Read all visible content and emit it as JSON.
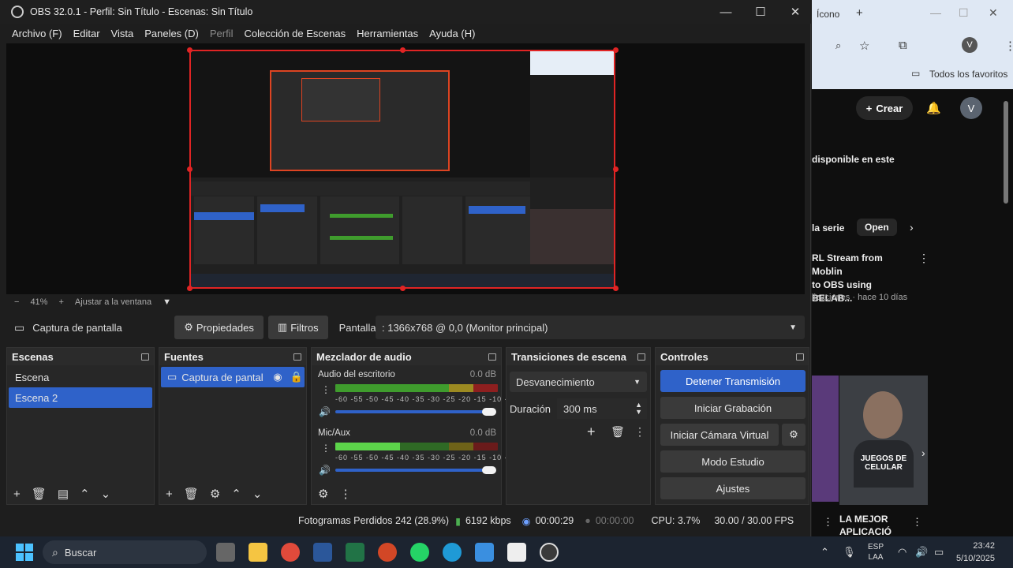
{
  "window": {
    "title": "OBS 32.0.1 - Perfil: Sin Título - Escenas: Sin Título",
    "minimize": "—",
    "maximize": "☐",
    "close": "✕"
  },
  "menu": [
    "Archivo (F)",
    "Editar",
    "Vista",
    "Paneles (D)",
    "Perfil",
    "Colección de Escenas",
    "Herramientas",
    "Ayuda (H)"
  ],
  "zoom": {
    "minus": "−",
    "value": "41%",
    "plus": "+",
    "fit_label": "Ajustar a la ventana"
  },
  "source_bar": {
    "source_name": "Captura de pantalla",
    "properties": "Propiedades",
    "filters": "Filtros",
    "display_label": "Pantalla",
    "display_value": ": 1366x768 @ 0,0 (Monitor principal)"
  },
  "scenes": {
    "title": "Escenas",
    "items": [
      "Escena",
      "Escena 2"
    ],
    "selected": 1
  },
  "sources": {
    "title": "Fuentes",
    "items": [
      "Captura de pantal"
    ]
  },
  "mixer": {
    "title": "Mezclador de audio",
    "tracks": [
      {
        "name": "Audio del escritorio",
        "db": "0.0 dB",
        "level": 0.77
      },
      {
        "name": "Mic/Aux",
        "db": "0.0 dB",
        "level": 0.6
      }
    ],
    "scale": "-60 -55 -50 -45 -40 -35 -30 -25 -20 -15 -10 -5 0"
  },
  "transitions": {
    "title": "Transiciones de escena",
    "selected": "Desvanecimiento",
    "duration_label": "Duración",
    "duration_value": "300 ms"
  },
  "controls": {
    "title": "Controles",
    "buttons": [
      "Detener Transmisión",
      "Iniciar Grabación",
      "Iniciar Cámara Virtual",
      "Modo Estudio",
      "Ajustes"
    ]
  },
  "status": {
    "dropped": "Fotogramas Perdidos 242 (28.9%)",
    "bitrate": "6192 kbps",
    "stream_time": "00:00:29",
    "rec_time": "00:00:00",
    "cpu": "CPU: 3.7%",
    "fps": "30.00 / 30.00 FPS"
  },
  "browser": {
    "tab_title": "Ícono",
    "favorites": "Todos los favoritos",
    "create": "Crear",
    "avatar": "V",
    "available": "disponible en este",
    "chip1": "la serie",
    "chip2": "Open",
    "video_title": "RL Stream from Moblin\nto OBS using BELAB...",
    "video_meta": "lizaciones · hace 10 días",
    "thumb_text": "JUEGOS DE\nCELULAR",
    "video2_title": "LA MEJOR\nAPLICACIÓ"
  },
  "taskbar": {
    "search": "Buscar",
    "lang": "ESP\nLAA",
    "time": "23:42",
    "date": "5/10/2025"
  },
  "colors": {
    "accent": "#2f62c9",
    "selection_red": "#e02424",
    "meter_green": "#3f9c2d",
    "meter_yellow": "#9c8a21",
    "meter_red": "#8e1f1f"
  }
}
